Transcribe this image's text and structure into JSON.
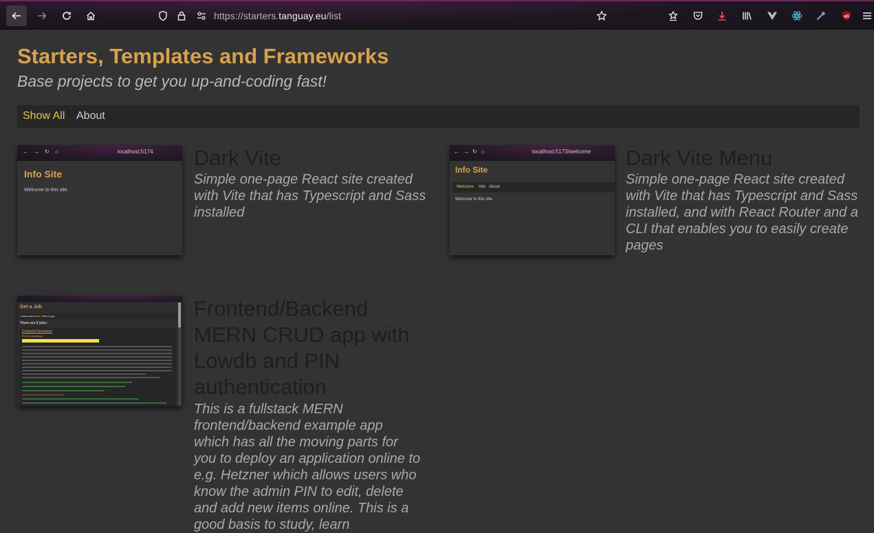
{
  "browser": {
    "url_prefix": "https://starters.",
    "url_host": "tanguay.eu",
    "url_path": "/list"
  },
  "header": {
    "title": "Starters, Templates and Frameworks",
    "subtitle": "Base projects to get you up-and-coding fast!"
  },
  "nav": {
    "show_all": "Show All",
    "about": "About"
  },
  "cards": [
    {
      "title": "Dark Vite",
      "description": "Simple one-page React site created with Vite that has Typescript and Sass installed",
      "thumb": {
        "url": "localhost:5174",
        "heading": "Info Site",
        "text": "Welcome to this site."
      }
    },
    {
      "title": "Dark Vite Menu",
      "description": "Simple one-page React site created with Vite that has Typescript and Sass installed, and with React Router and a CLI that enables you to easily create pages",
      "thumb": {
        "url": "localhost:5173/welcome",
        "heading": "Info Site",
        "nav": [
          "Welcome",
          "Info",
          "About"
        ],
        "text": "Welcome to this site."
      }
    },
    {
      "title": "Frontend/Backend MERN CRUD app with Lowdb and PIN authentication",
      "description": "This is a fullstack MERN frontend/backend example app which has all the moving parts for you to deploy an application online to e.g. Hetzner which allows users who know the admin PIN to edit, delete and add new items online. This is a good basis to study, learn",
      "thumb": {
        "heading": "Get a Job",
        "nav": [
          "Dashboard",
          "Jobs",
          "Skills",
          "Login"
        ],
        "count_text": "There are 5 jobs:",
        "job_title": "Frontend Developer",
        "job_company": "Perl Deutschland"
      }
    }
  ],
  "colors": {
    "accent": "#d6a24e",
    "nav_active": "#e0cc4a",
    "background": "#333333"
  }
}
